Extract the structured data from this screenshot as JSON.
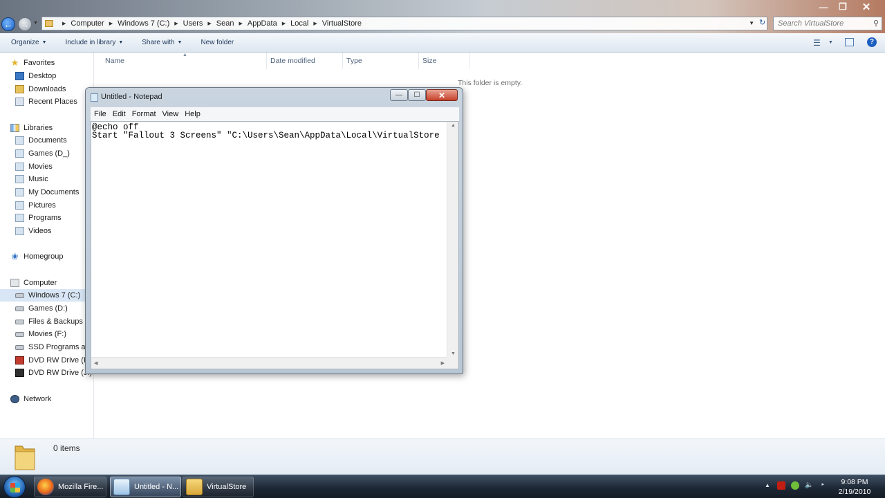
{
  "explorer": {
    "breadcrumbs": [
      "Computer",
      "Windows 7 (C:)",
      "Users",
      "Sean",
      "AppData",
      "Local",
      "VirtualStore"
    ],
    "search_placeholder": "Search VirtualStore",
    "toolbar": {
      "organize": "Organize",
      "include_in_library": "Include in library",
      "share_with": "Share with",
      "new_folder": "New folder"
    },
    "nav": {
      "favorites": "Favorites",
      "desktop": "Desktop",
      "downloads": "Downloads",
      "recent_places": "Recent Places",
      "libraries": "Libraries",
      "documents": "Documents",
      "games_d": "Games (D_)",
      "movies": "Movies",
      "music": "Music",
      "my_documents": "My Documents",
      "pictures": "Pictures",
      "programs": "Programs",
      "videos": "Videos",
      "homegroup": "Homegroup",
      "computer": "Computer",
      "windows7": "Windows 7 (C:)",
      "games_drive": "Games (D:)",
      "files_backups": "Files & Backups (E",
      "movies_drive": "Movies (F:)",
      "ssd_programs": "SSD Programs and",
      "dvd_i": "DVD RW Drive (I:)",
      "dvd_j": "DVD RW Drive (J:) D",
      "network": "Network"
    },
    "columns": [
      "Name",
      "Date modified",
      "Type",
      "Size"
    ],
    "empty_message": "This folder is empty.",
    "details": {
      "item_count": "0 items"
    }
  },
  "notepad": {
    "title": "Untitled - Notepad",
    "menu": [
      "File",
      "Edit",
      "Format",
      "View",
      "Help"
    ],
    "content": "@echo off\nStart \"Fallout 3 Screens\" \"C:\\Users\\Sean\\AppData\\Local\\VirtualStore"
  },
  "taskbar": {
    "buttons": [
      "Mozilla Fire...",
      "Untitled - N...",
      "VirtualStore"
    ],
    "time": "9:08 PM",
    "date": "2/19/2010"
  },
  "colors": {
    "selection": "#d8e6f5",
    "link_blue": "#1e395b",
    "close_red": "#c6402a"
  }
}
